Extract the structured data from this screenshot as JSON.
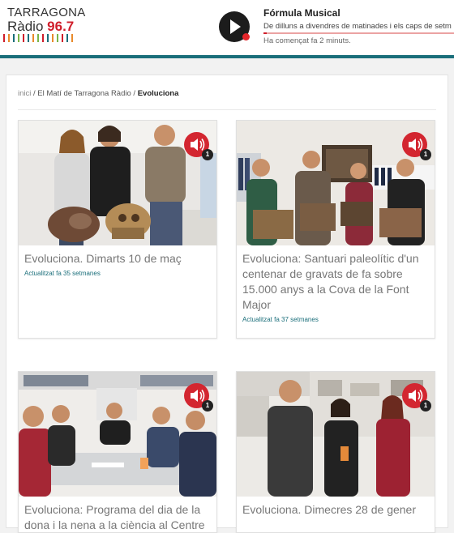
{
  "header": {
    "logo_line1": "TARRAGONA",
    "logo_line2_word": "Ràdio",
    "logo_line2_freq": "96.7",
    "logo_bar_colors": [
      "#d01e2b",
      "#e98a2b",
      "#1a6e7a",
      "#7ab648",
      "#d01e2b",
      "#1a6e7a",
      "#e98a2b",
      "#7ab648",
      "#d01e2b",
      "#1a6e7a",
      "#e98a2b",
      "#7ab648",
      "#d01e2b",
      "#1a6e7a",
      "#e98a2b"
    ],
    "accent_color": "#1a6e7a",
    "brand_red": "#d01e2b"
  },
  "player": {
    "icon": "play-icon",
    "now_playing_title": "Fórmula Musical",
    "now_playing_desc": "De dilluns a divendres de matinades i els caps de setm",
    "started": "Ha començat fa 2 minuts."
  },
  "breadcrumb": {
    "home": "inici",
    "sep": "/",
    "parent": "El Matí de Tarragona Ràdio",
    "current": "Evoluciona"
  },
  "cards": [
    {
      "title": "Evoluciona. Dimarts 10 de maç",
      "updated": "Actualitzat fa 35 setmanes",
      "audio_count": "1"
    },
    {
      "title": "Evoluciona: Santuari paleolític d'un centenar de gravats de fa sobre 15.000 anys a la Cova de la Font Major",
      "updated": "Actualitzat fa 37 setmanes",
      "audio_count": "1"
    },
    {
      "title": "Evoluciona: Programa del dia de la dona i la nena a la ciència al Centre",
      "updated": "",
      "audio_count": "1"
    },
    {
      "title": "Evoluciona. Dimecres 28 de gener",
      "updated": "",
      "audio_count": "1"
    }
  ]
}
